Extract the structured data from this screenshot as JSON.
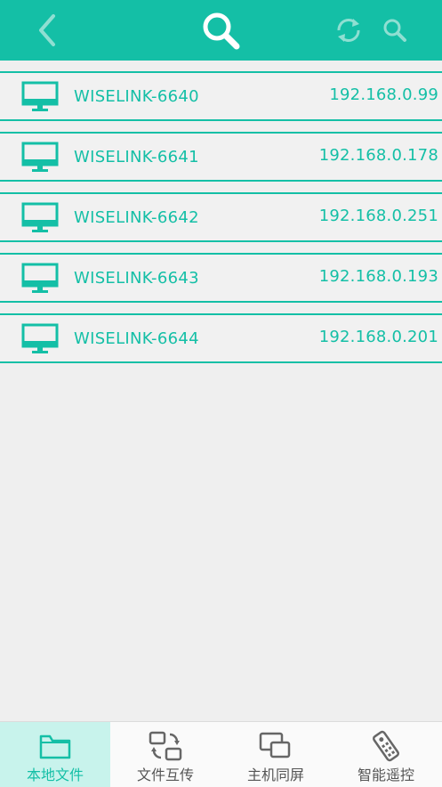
{
  "header": {
    "back_icon": "chevron-left-icon",
    "search_icon": "search-icon",
    "refresh_icon": "refresh-icon",
    "small_search_icon": "search-icon",
    "accent": "#14bfa6"
  },
  "devices": [
    {
      "name": "WISELINK-6640",
      "ip": "192.168.0.99"
    },
    {
      "name": "WISELINK-6641",
      "ip": "192.168.0.178"
    },
    {
      "name": "WISELINK-6642",
      "ip": "192.168.0.251"
    },
    {
      "name": "WISELINK-6643",
      "ip": "192.168.0.193"
    },
    {
      "name": "WISELINK-6644",
      "ip": "192.168.0.201"
    }
  ],
  "tabs": [
    {
      "label": "本地文件",
      "icon": "folder-icon",
      "active": true
    },
    {
      "label": "文件互传",
      "icon": "transfer-icon",
      "active": false
    },
    {
      "label": "主机同屏",
      "icon": "screen-mirror-icon",
      "active": false
    },
    {
      "label": "智能遥控",
      "icon": "remote-control-icon",
      "active": false
    }
  ]
}
